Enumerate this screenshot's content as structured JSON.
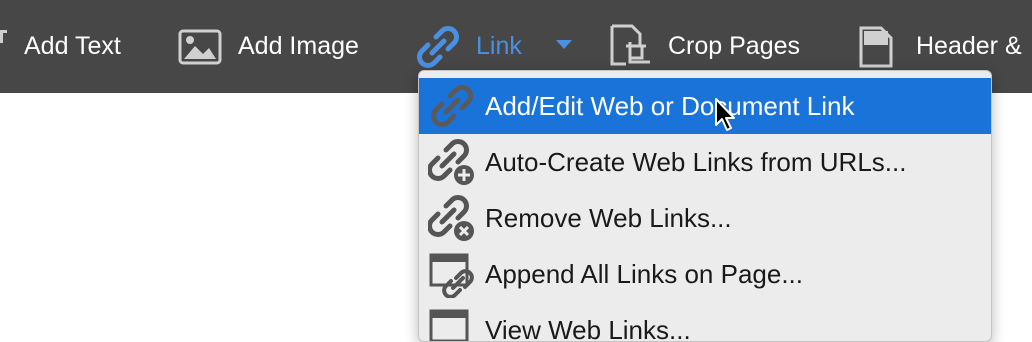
{
  "toolbar": {
    "items": [
      {
        "label": "Add Text",
        "icon": "add-text-icon"
      },
      {
        "label": "Add Image",
        "icon": "image-icon"
      },
      {
        "label": "Link",
        "icon": "link-icon",
        "active": true
      },
      {
        "label": "Crop Pages",
        "icon": "crop-icon"
      },
      {
        "label": "Header &",
        "icon": "document-icon"
      }
    ]
  },
  "menu": {
    "items": [
      {
        "label": "Add/Edit Web or Document Link",
        "icon": "link-icon",
        "selected": true
      },
      {
        "label": "Auto-Create Web Links from URLs...",
        "icon": "link-add-icon"
      },
      {
        "label": "Remove Web Links...",
        "icon": "link-remove-icon"
      },
      {
        "label": "Append All Links on Page...",
        "icon": "page-link-icon"
      },
      {
        "label": "View Web Links...",
        "icon": "page-view-icon"
      }
    ]
  },
  "colors": {
    "toolbar_bg": "#474747",
    "accent": "#4a90e2",
    "menu_selected": "#1a73d9",
    "menu_bg": "#ececec"
  }
}
